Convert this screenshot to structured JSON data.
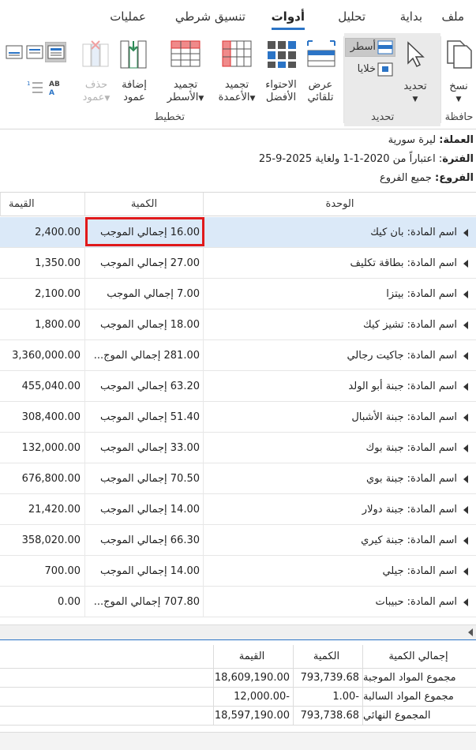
{
  "menu": {
    "tabs": [
      {
        "label": "ملف"
      },
      {
        "label": "بداية"
      },
      {
        "label": "تحليل"
      },
      {
        "label": "أدوات"
      },
      {
        "label": "تنسيق شرطي"
      },
      {
        "label": "عمليات"
      }
    ],
    "active": "أدوات"
  },
  "ribbon": {
    "copy": "نسخ",
    "select": "تحديد",
    "rows": "أسطر",
    "cells": "خلايا",
    "autofit_line1": "عرض",
    "autofit_line2": "تلقائي",
    "bestfit_line1": "الاحتواء",
    "bestfit_line2": "الأفضل",
    "freeze_cols_line1": "تجميد",
    "freeze_cols_line2": "الأعمدة",
    "freeze_rows_line1": "تجميد",
    "freeze_rows_line2": "الأسطر",
    "add_col_line1": "إضافة",
    "add_col_line2": "عمود",
    "del_col_line1": "حذف",
    "del_col_line2": "عمود",
    "groups": {
      "clipboard": "حافظة",
      "selection": "تحديد",
      "layout": "تخطيط"
    }
  },
  "info": {
    "currency_label": "العملة:",
    "currency": "ليرة سورية",
    "period_label": "الفترة",
    "period": ": اعتباراً من 2020-1-1 ولغاية 2025-9-25",
    "branches_label": "الفروع:",
    "branches": "جميع الفروع"
  },
  "grid": {
    "headers": {
      "unit": "الوحدة",
      "qty": "الكمية",
      "value": "القيمة"
    },
    "rows": [
      {
        "unit": "اسم المادة: بان كيك",
        "qty": "16.00 إجمالي الموجب",
        "value": "2,400.00"
      },
      {
        "unit": "اسم المادة: بطاقة تكليف",
        "qty": "27.00 إجمالي الموجب",
        "value": "1,350.00"
      },
      {
        "unit": "اسم المادة: بيتزا",
        "qty": "7.00 إجمالي الموجب",
        "value": "2,100.00"
      },
      {
        "unit": "اسم المادة: تشيز كيك",
        "qty": "18.00 إجمالي الموجب",
        "value": "1,800.00"
      },
      {
        "unit": "اسم المادة: جاكيت رجالي",
        "qty": "281.00 إجمالي الموج...",
        "value": "3,360,000.00"
      },
      {
        "unit": "اسم المادة: جبنة أبو الولد",
        "qty": "63.20 إجمالي الموجب",
        "value": "455,040.00"
      },
      {
        "unit": "اسم المادة: جبنة الأشبال",
        "qty": "51.40 إجمالي الموجب",
        "value": "308,400.00"
      },
      {
        "unit": "اسم المادة: جبنة بوك",
        "qty": "33.00 إجمالي الموجب",
        "value": "132,000.00"
      },
      {
        "unit": "اسم المادة: جبنة بوي",
        "qty": "70.50 إجمالي الموجب",
        "value": "676,800.00"
      },
      {
        "unit": "اسم المادة: جبنة دولار",
        "qty": "14.00 إجمالي الموجب",
        "value": "21,420.00"
      },
      {
        "unit": "اسم المادة: جبنة كيري",
        "qty": "66.30 إجمالي الموجب",
        "value": "358,020.00"
      },
      {
        "unit": "اسم المادة: جيلي",
        "qty": "14.00 إجمالي الموجب",
        "value": "700.00"
      },
      {
        "unit": "اسم المادة: حبيبات",
        "qty": "707.80 إجمالي الموج...",
        "value": "0.00"
      }
    ]
  },
  "summary": {
    "headers": {
      "label": "إجمالي الكمية",
      "qty": "الكمية",
      "value": "القيمة"
    },
    "rows": [
      {
        "label": "مجموع المواد الموجبة",
        "qty": "793,739.68",
        "value": "18,609,190.00"
      },
      {
        "label": "مجموع المواد السالبة",
        "qty": "1.00-",
        "value": "12,000.00-"
      },
      {
        "label": "المجموع النهائي",
        "qty": "793,738.68",
        "value": "18,597,190.00"
      }
    ]
  },
  "colors": {
    "accent": "#2b74c6",
    "selected_row": "#dbe9f8",
    "highlight": "#e0191b"
  }
}
